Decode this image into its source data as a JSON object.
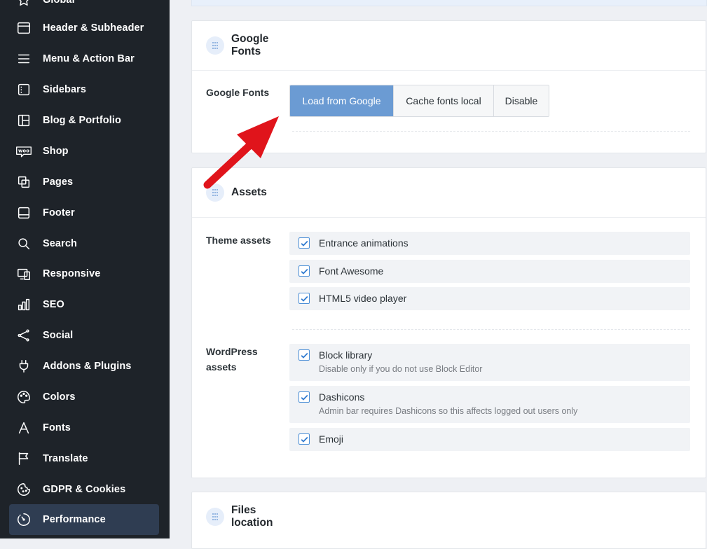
{
  "sidebar": {
    "items": [
      {
        "label": "Global",
        "icon": "star-icon"
      },
      {
        "label": "Header & Subheader",
        "icon": "header-icon"
      },
      {
        "label": "Menu & Action Bar",
        "icon": "menu-icon"
      },
      {
        "label": "Sidebars",
        "icon": "sidebar-icon"
      },
      {
        "label": "Blog & Portfolio",
        "icon": "layout-icon"
      },
      {
        "label": "Shop",
        "icon": "woo-icon"
      },
      {
        "label": "Pages",
        "icon": "pages-icon"
      },
      {
        "label": "Footer",
        "icon": "footer-icon"
      },
      {
        "label": "Search",
        "icon": "search-icon"
      },
      {
        "label": "Responsive",
        "icon": "responsive-icon"
      },
      {
        "label": "SEO",
        "icon": "seo-icon"
      },
      {
        "label": "Social",
        "icon": "share-icon"
      },
      {
        "label": "Addons & Plugins",
        "icon": "plug-icon"
      },
      {
        "label": "Colors",
        "icon": "palette-icon"
      },
      {
        "label": "Fonts",
        "icon": "font-icon"
      },
      {
        "label": "Translate",
        "icon": "flag-icon"
      },
      {
        "label": "GDPR & Cookies",
        "icon": "cookie-icon"
      },
      {
        "label": "Performance",
        "icon": "performance-icon",
        "active": true
      }
    ]
  },
  "google_fonts": {
    "title": "Google Fonts",
    "row_label": "Google Fonts",
    "options": [
      "Load from Google",
      "Cache fonts local",
      "Disable"
    ],
    "selected": "Load from Google"
  },
  "assets": {
    "title": "Assets",
    "theme_label": "Theme assets",
    "theme_items": [
      {
        "label": "Entrance animations",
        "checked": true
      },
      {
        "label": "Font Awesome",
        "checked": true
      },
      {
        "label": "HTML5 video player",
        "checked": true
      }
    ],
    "wp_label": "WordPress assets",
    "wp_items": [
      {
        "label": "Block library",
        "desc": "Disable only if you do not use Block Editor",
        "checked": true
      },
      {
        "label": "Dashicons",
        "desc": "Admin bar requires Dashicons so this affects logged out users only",
        "checked": true
      },
      {
        "label": "Emoji",
        "checked": true
      }
    ]
  },
  "files_location": {
    "title": "Files location"
  },
  "colors": {
    "sidebar_bg": "#1e2329",
    "active_bg": "#2f3d52",
    "accent": "#6b9bd3",
    "arrow": "#e0141b"
  }
}
